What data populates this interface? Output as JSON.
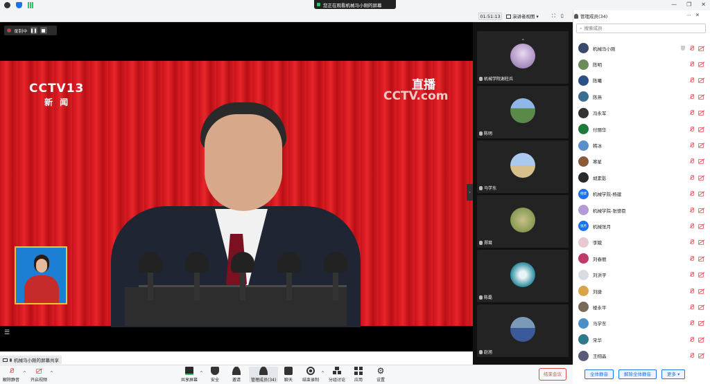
{
  "titlebar": {
    "share_notice": "您正在观看机械马小刚的屏幕"
  },
  "subbar": {
    "timer": "01:51:13",
    "view_mode": "演讲者视图"
  },
  "stage": {
    "record_label": "录制中",
    "video": {
      "channel_logo": "CCTV13",
      "channel_sub": "新 闻",
      "live_tag": "直播",
      "live_logo": "CCTV.com"
    },
    "share_label": "机械马小刚的屏幕共享"
  },
  "gallery": {
    "tiles": [
      {
        "name": "机械学院谢柱兵"
      },
      {
        "name": "陈明"
      },
      {
        "name": "马学东"
      },
      {
        "name": "郑茸"
      },
      {
        "name": "陈磊"
      },
      {
        "name": "赵旭"
      }
    ]
  },
  "panel": {
    "title": "管理成员(34)",
    "search_placeholder": "搜索成员",
    "participants": [
      {
        "name": "机械马小刚",
        "avatar": "#3b4a6b"
      },
      {
        "name": "陈明",
        "avatar": "#6c8b5a"
      },
      {
        "name": "陈曦",
        "avatar": "#2b4f88"
      },
      {
        "name": "陈燕",
        "avatar": "#3a6f8f"
      },
      {
        "name": "冯永军",
        "avatar": "#333333"
      },
      {
        "name": "付丽华",
        "avatar": "#1f7a3a"
      },
      {
        "name": "韩冰",
        "avatar": "#5a8fc9"
      },
      {
        "name": "寒星",
        "avatar": "#8a5a3a"
      },
      {
        "name": "胡素影",
        "avatar": "#2a2a2a"
      },
      {
        "name": "机械学院-杨建",
        "avatar": "#1a73e8",
        "initials": "杨建"
      },
      {
        "name": "机械学院-张德臣",
        "avatar": "#b49ad6"
      },
      {
        "name": "机械张月",
        "avatar": "#1a73e8",
        "initials": "张月"
      },
      {
        "name": "李娥",
        "avatar": "#e7c9d0"
      },
      {
        "name": "刘春丽",
        "avatar": "#c23a6a"
      },
      {
        "name": "刘洪宇",
        "avatar": "#d8dbe0"
      },
      {
        "name": "刘捷",
        "avatar": "#d9a44a"
      },
      {
        "name": "楼永平",
        "avatar": "#7a6a5a"
      },
      {
        "name": "马学东",
        "avatar": "#4a90c8"
      },
      {
        "name": "宋华",
        "avatar": "#2f7a8a"
      },
      {
        "name": "王栩晶",
        "avatar": "#5a5a7a"
      }
    ],
    "footer": {
      "mute_all": "全体静音",
      "unmute_all": "解除全体静音",
      "more": "更多"
    }
  },
  "toolbar": {
    "unmute": "解除静音",
    "start_video": "开启视频",
    "share_screen": "共享屏幕",
    "security": "安全",
    "invite": "邀请",
    "participants": "管理成员(34)",
    "chat": "聊天",
    "record": "结束录制",
    "breakout": "分组讨论",
    "apps": "应用",
    "settings": "设置",
    "end": "结束会议"
  },
  "colors": {
    "accent": "#1a73e8",
    "danger": "#e04848",
    "stage_red": "#d81d22"
  }
}
